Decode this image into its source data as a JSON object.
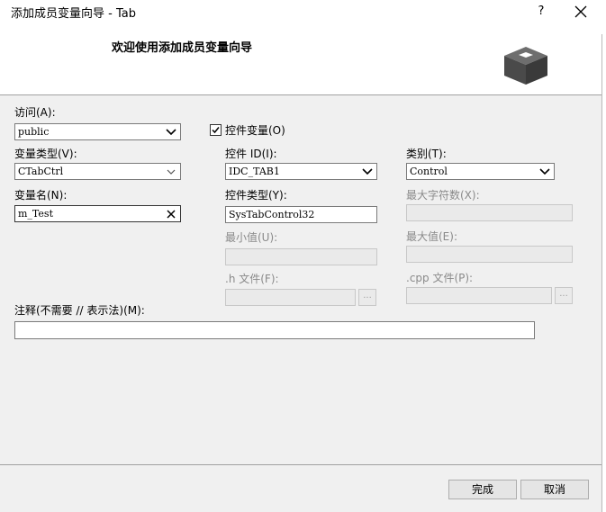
{
  "window": {
    "title": "添加成员变量向导 - Tab",
    "help_label": "?",
    "close_icon": "close-icon"
  },
  "header": {
    "title": "欢迎使用添加成员变量向导",
    "icon": "box-3d-icon"
  },
  "form": {
    "access": {
      "label": "访问(A):",
      "value": "public"
    },
    "control_var": {
      "label": "控件变量(O)",
      "checked": true
    },
    "var_type": {
      "label": "变量类型(V):",
      "value": "CTabCtrl"
    },
    "control_id": {
      "label": "控件 ID(I):",
      "value": "IDC_TAB1"
    },
    "category": {
      "label": "类别(T):",
      "value": "Control"
    },
    "var_name": {
      "label": "变量名(N):",
      "value": "m_Test"
    },
    "control_type": {
      "label": "控件类型(Y):",
      "value": "SysTabControl32"
    },
    "max_chars": {
      "label": "最大字符数(X):",
      "value": ""
    },
    "min_value": {
      "label": "最小值(U):",
      "value": ""
    },
    "max_value": {
      "label": "最大值(E):",
      "value": ""
    },
    "h_file": {
      "label": ".h 文件(F):",
      "value": "",
      "browse_label": "..."
    },
    "cpp_file": {
      "label": ".cpp 文件(P):",
      "value": "",
      "browse_label": "..."
    },
    "comment": {
      "label": "注释(不需要 // 表示法)(M):",
      "value": ""
    }
  },
  "footer": {
    "finish_label": "完成",
    "cancel_label": "取消"
  },
  "colors": {
    "body_bg": "#f0f0f0",
    "disabled_text": "#8a8a8a"
  }
}
